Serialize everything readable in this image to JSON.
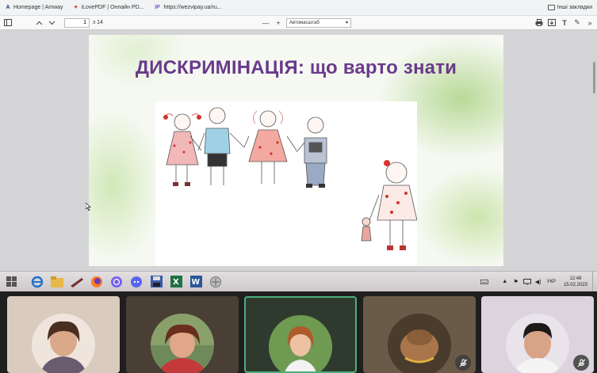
{
  "browser": {
    "bookmarks": [
      {
        "label": "Homepage | Amway",
        "icon": "amway-icon",
        "glyph": "A"
      },
      {
        "label": "iLovePDF | Онлайн PD...",
        "icon": "ilovepdf-icon",
        "glyph": "♥"
      },
      {
        "label": "https://wezvipay.ua/ru...",
        "icon": "web-page-icon",
        "glyph": "iP"
      }
    ],
    "other_bookmarks": "Інші закладки"
  },
  "pdf_viewer": {
    "page_current": "1",
    "page_total": "з 14",
    "zoom": "Автомасштаб",
    "zoom_minus": "—",
    "zoom_plus": "+"
  },
  "slide": {
    "title": "ДИСКРИМІНАЦІЯ: що варто знати",
    "title_color": "#6a3a8c"
  },
  "taskbar": {
    "apps": [
      "start-button",
      "internet-explorer-icon",
      "file-explorer-icon",
      "app-icon",
      "firefox-icon",
      "viber-icon",
      "discord-icon",
      "save-icon",
      "excel-icon",
      "word-icon",
      "network-app-icon"
    ],
    "language": "УКР",
    "time": "12:48",
    "date": "15.02.2023"
  },
  "call": {
    "participants": [
      {
        "id": "participant-1",
        "bg": "#d9cbbd",
        "mic_off": false
      },
      {
        "id": "participant-2",
        "bg": "#4a3f34",
        "mic_off": false
      },
      {
        "id": "participant-3",
        "bg": "#2f3a2f",
        "mic_off": false,
        "speaking": true
      },
      {
        "id": "participant-4",
        "bg": "#6a5a48",
        "mic_off": true
      },
      {
        "id": "participant-5",
        "bg": "#dcd3df",
        "mic_off": true
      }
    ],
    "speaking_color": "#4caf7a"
  }
}
